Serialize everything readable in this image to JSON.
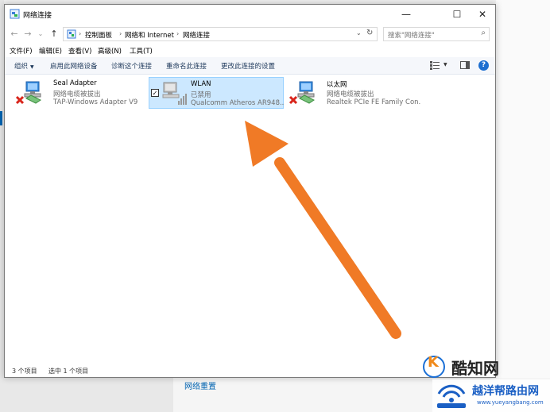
{
  "window": {
    "title": "网络连接",
    "minimize": "—",
    "maximize": "☐",
    "close": "✕"
  },
  "nav": {
    "back": "←",
    "forward": "→",
    "recent": "⌄",
    "up": "↑"
  },
  "address": {
    "sep": "›",
    "crumbs": [
      "控制面板",
      "网络和 Internet",
      "网络连接"
    ]
  },
  "search": {
    "placeholder": "搜索\"网络连接\""
  },
  "menu": [
    "文件(F)",
    "编辑(E)",
    "查看(V)",
    "高级(N)",
    "工具(T)"
  ],
  "commands": {
    "organize": "组织",
    "enable": "启用此网络设备",
    "diagnose": "诊断这个连接",
    "rename": "重命名此连接",
    "change": "更改此连接的设置"
  },
  "help_label": "?",
  "connections": [
    {
      "name": "Seal Adapter",
      "status": "网络电缆被拔出",
      "device": "TAP-Windows Adapter V9",
      "selected": false,
      "icon": "network-adapter-disconnected-icon"
    },
    {
      "name": "WLAN",
      "status": "已禁用",
      "device": "Qualcomm Atheros AR948...",
      "selected": true,
      "icon": "wlan-adapter-disabled-icon"
    },
    {
      "name": "以太网",
      "status": "网络电缆被拔出",
      "device": "Realtek PCIe FE Family Con...",
      "selected": false,
      "icon": "ethernet-adapter-disconnected-icon"
    }
  ],
  "status": {
    "count": "3 个项目",
    "selected": "选中 1 个项目"
  },
  "background": {
    "link": "网络重置"
  },
  "watermark": {
    "brand1": "酷知网",
    "brand1_mark": "K",
    "brand2": "越洋帮路由网",
    "brand2_url": "www.yueyangbang.com"
  },
  "colors": {
    "arrow": "#f07a26",
    "selection": "#cce8ff",
    "accent": "#0063b1"
  }
}
